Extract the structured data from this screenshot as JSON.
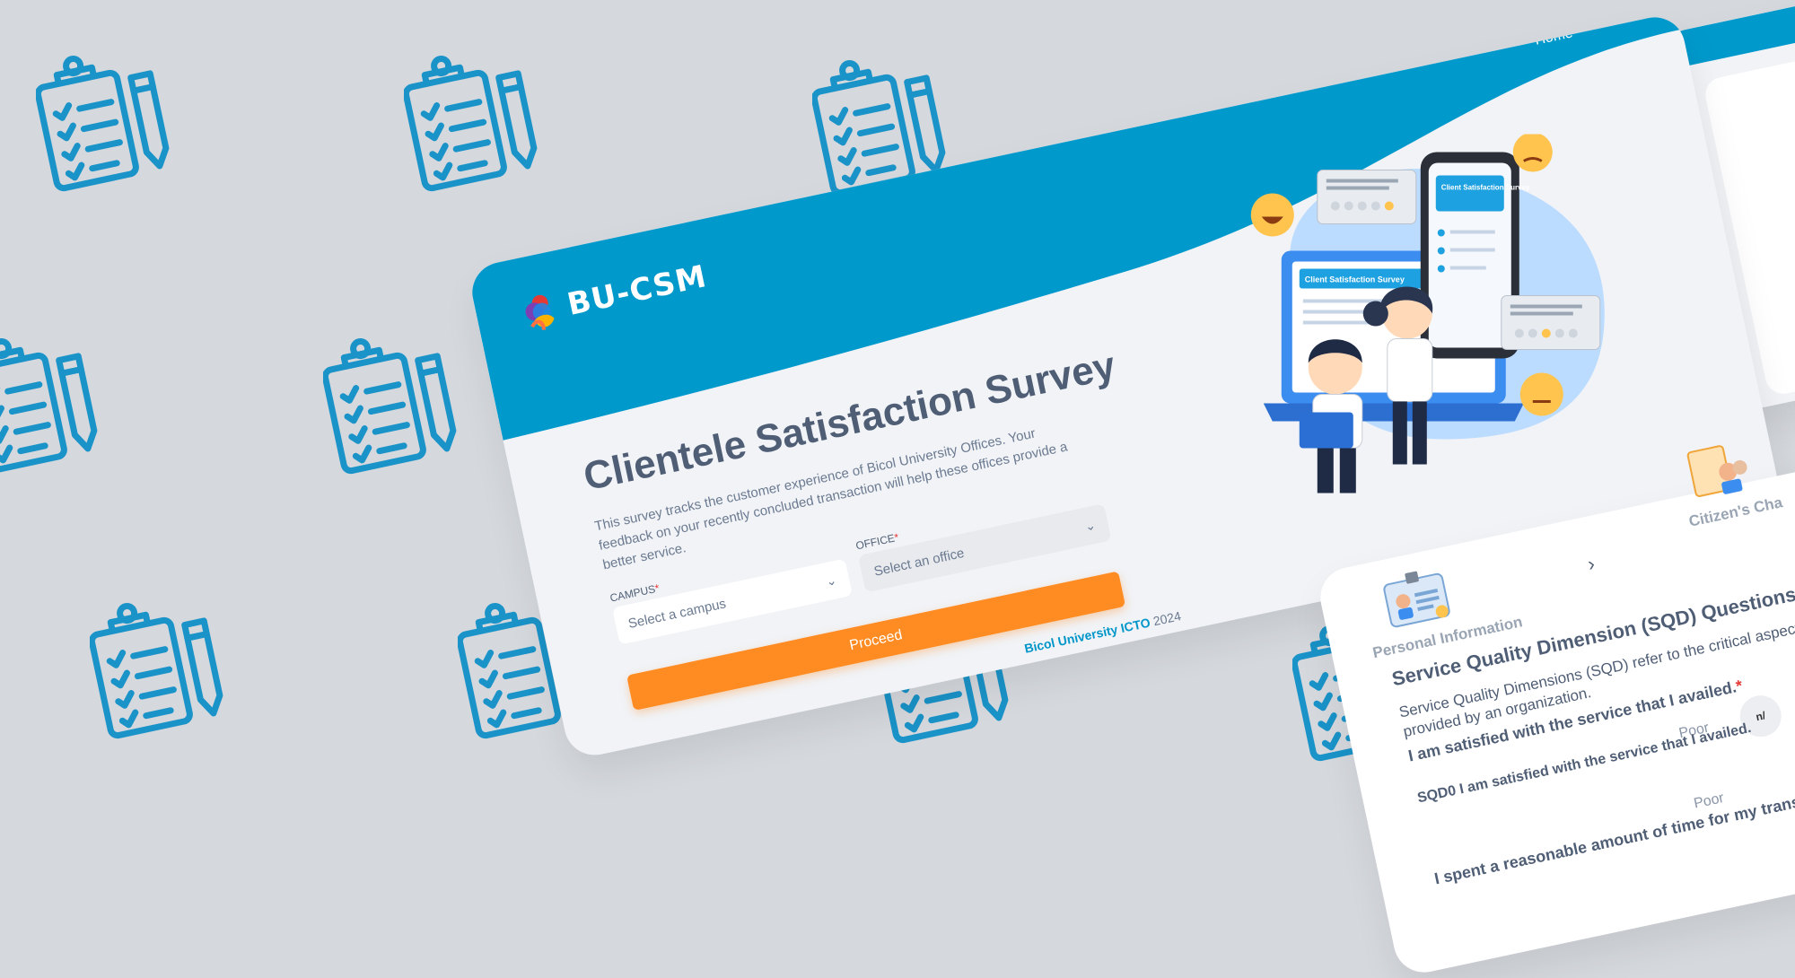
{
  "colors": {
    "brand_blue": "#0099cc",
    "accent_orange": "#ff8c22",
    "bg_gray": "#d5d8dd",
    "card_bg": "#f1f3f7",
    "text_dark": "#4f5e75"
  },
  "background": {
    "icon": "clipboard-pencil-icon"
  },
  "main": {
    "logo_text": "BU-CSM",
    "nav_home": "Home",
    "title": "Clientele Satisfaction Survey",
    "description": "This survey tracks the customer experience of Bicol University Offices. Your feedback on your recently concluded transaction will help these offices provide a better service.",
    "campus_label": "CAMPUS",
    "campus_placeholder": "Select a campus",
    "office_label": "OFFICE",
    "office_placeholder": "Select an office",
    "required_mark": "*",
    "proceed_label": "Proceed",
    "footer_brand": "Bicol University ICTO",
    "footer_year": "2024",
    "illustration": {
      "laptop_title": "Client Satisfaction Survey",
      "phone_title": "Client Satisfaction Survey"
    }
  },
  "sqd": {
    "step1_label": "Personal Information",
    "step2_label": "Citizen's Cha",
    "title": "Service Quality Dimension (SQD) Questions",
    "description": "Service Quality Dimensions (SQD) refer to the critical aspects, inc quality of services provided by an organization.",
    "q_intro": "I am satisfied with the service that I availed.",
    "q0": "SQD0 I am satisfied with the service that I availed.",
    "q1": "I spent a reasonable amount of time for my transactio",
    "poor": "Poor",
    "na": "n/"
  }
}
